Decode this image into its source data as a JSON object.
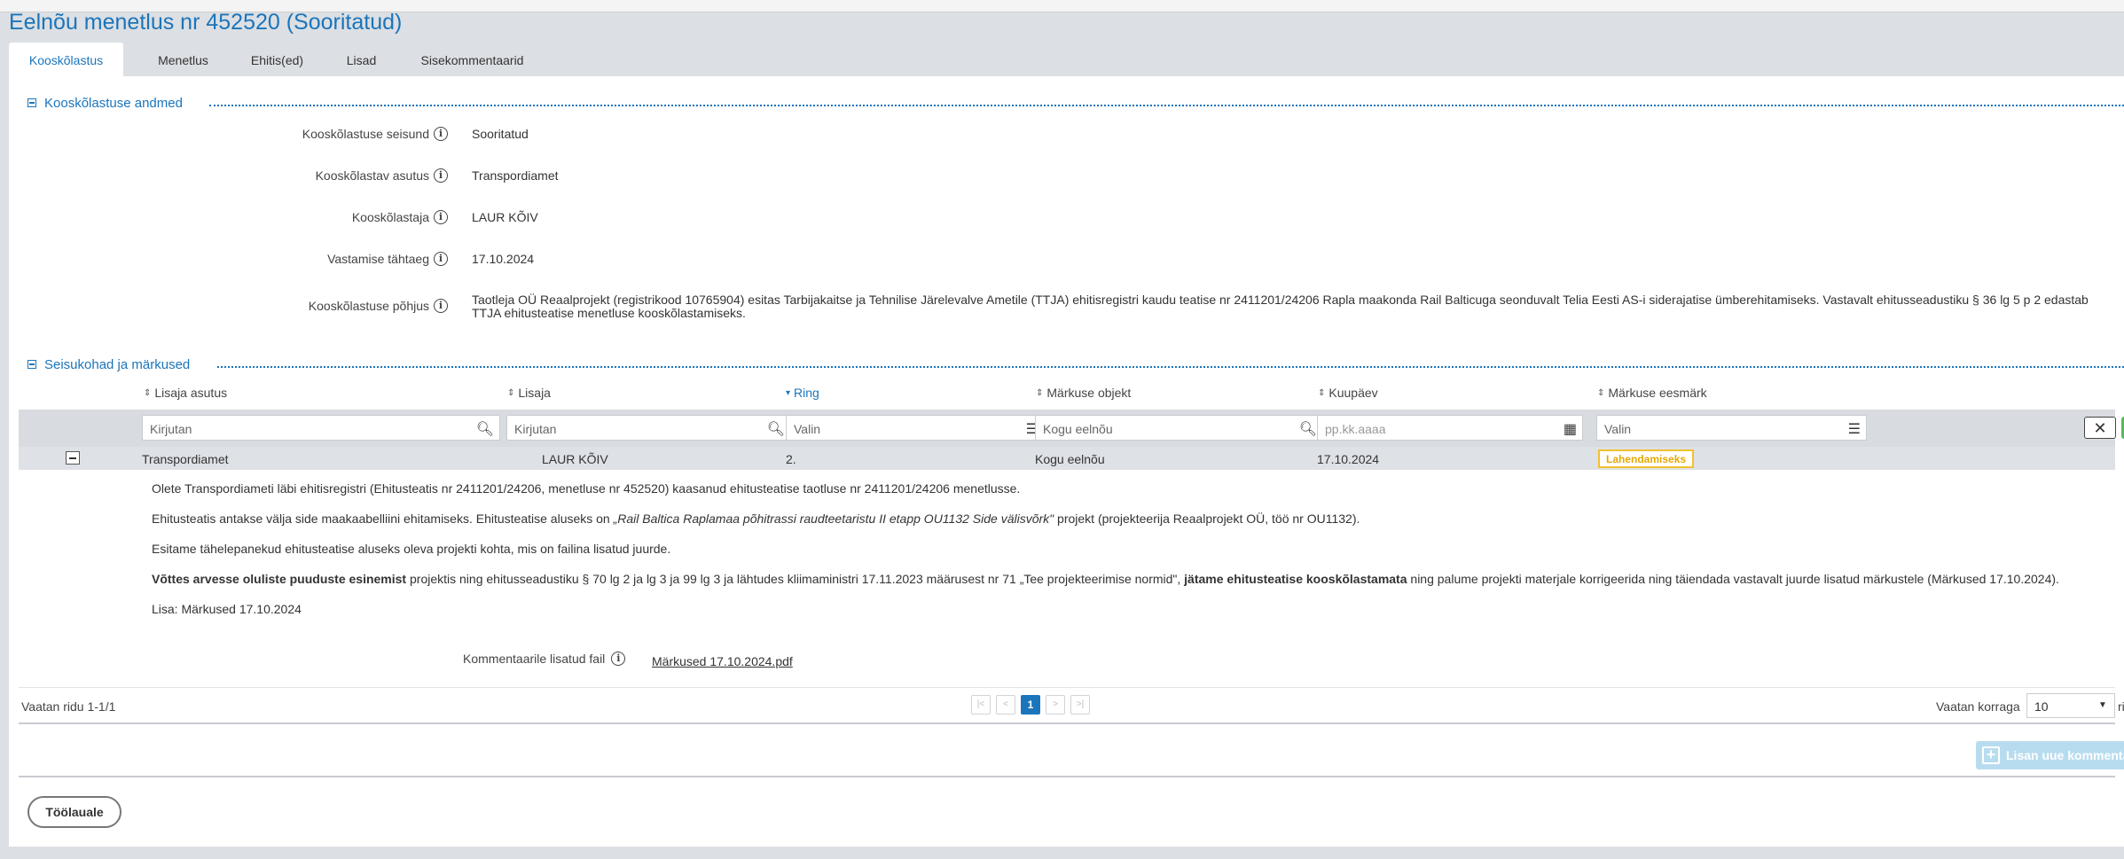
{
  "page": {
    "title": "Eelnõu menetlus nr 452520 (Sooritatud)"
  },
  "tabs": [
    {
      "label": "Kooskõlastus",
      "active": true
    },
    {
      "label": "Menetlus"
    },
    {
      "label": "Ehitis(ed)"
    },
    {
      "label": "Lisad"
    },
    {
      "label": "Sisekommentaarid"
    }
  ],
  "section1": {
    "title": "Kooskõlastuse andmed",
    "fields": [
      {
        "label": "Kooskõlastuse seisund",
        "value": "Sooritatud"
      },
      {
        "label": "Kooskõlastav asutus",
        "value": "Transpordiamet"
      },
      {
        "label": "Kooskõlastaja",
        "value": "LAUR KÕIV"
      },
      {
        "label": "Vastamise tähtaeg",
        "value": "17.10.2024"
      },
      {
        "label": "Kooskõlastuse põhjus",
        "value": "Taotleja OÜ Reaalprojekt (registrikood 10765904) esitas Tarbijakaitse ja Tehnilise Järelevalve Ametile (TTJA) ehitisregistri kaudu teatise nr 2411201/24206 Rapla maakonda Rail Balticuga seonduvalt Telia Eesti AS-i siderajatise ümberehitamiseks. Vastavalt ehitusseadustiku § 36 lg 5 p 2 edastab TTJA ehitusteatise menetluse kooskõlastamiseks."
      }
    ]
  },
  "section2": {
    "title": "Seisukohad ja märkused",
    "columns": [
      "Lisaja asutus",
      "Lisaja",
      "Ring",
      "Märkuse objekt",
      "Kuupäev",
      "Märkuse eesmärk"
    ],
    "filters": [
      "Kirjutan",
      "Kirjutan",
      "Valin",
      "Kogu eelnõu",
      "pp.kk.aaaa",
      "Valin"
    ],
    "row": {
      "asutus": "Transpordiamet",
      "lisaja": "LAUR KÕIV",
      "ring": "2.",
      "objekt": "Kogu eelnõu",
      "kuupaev": "17.10.2024",
      "eesmark": "Lahendamiseks"
    },
    "comment": {
      "p1": "Olete Transpordiameti läbi ehitisregistri (Ehitusteatis nr 2411201/24206, menetluse nr 452520) kaasanud ehitusteatise taotluse nr 2411201/24206 menetlusse.",
      "p2_a": "Ehitusteatis antakse välja side maakaabelliini ehitamiseks. Ehitusteatise aluseks on ",
      "p2_b": "„Rail Baltica Raplamaa põhitrassi raudteetaristu II etapp OU1132 Side välisvõrk\"",
      "p2_c": " projekt (projekteerija Reaalprojekt OÜ, töö nr OU1132).",
      "p3": "Esitame tähelepanekud ehitusteatise aluseks oleva projekti kohta, mis on failina lisatud juurde.",
      "p4_a": "Võttes arvesse oluliste puuduste esinemist",
      "p4_b": " projektis ning ehitusseadustiku § 70 lg 2 ja lg 3 ja 99 lg 3 ja lähtudes kliimaministri 17.11.2023 määrusest nr 71 „Tee projekteerimise normid\", ",
      "p4_c": "jätame ehitusteatise kooskõlastamata",
      "p4_d": " ning palume projekti materjale korrigeerida ning täiendada vastavalt juurde lisatud märkustele (Märkused 17.10.2024).",
      "p5": "Lisa: Märkused 17.10.2024"
    },
    "attachment": {
      "label": "Kommentaarile lisatud fail",
      "file": "Märkused 17.10.2024.pdf"
    },
    "pager": {
      "info": "Vaatan ridu 1-1/1",
      "current": "1",
      "perpage_label": "Vaatan korraga",
      "perpage_value": "10",
      "perpage_suffix": "ri"
    },
    "add_comment": "Lisan uue kommentaari"
  },
  "back_button": "Töölauale",
  "colors": {
    "accent": "#1b75bb",
    "badge": "#f2c12e",
    "panel_bg": "#dcdfe3"
  }
}
